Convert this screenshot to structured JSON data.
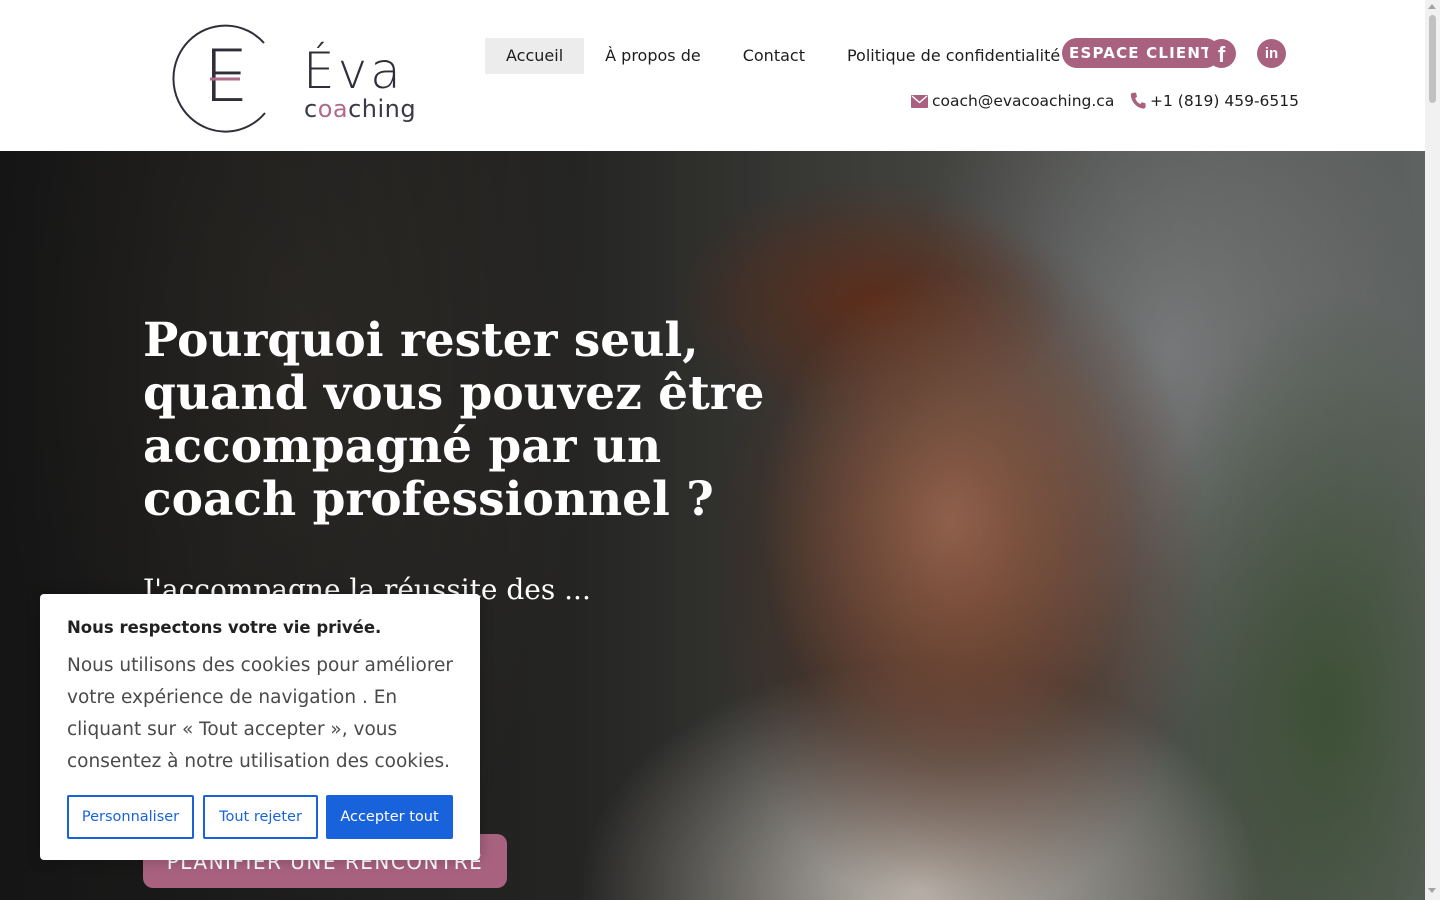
{
  "brand": {
    "logo_letter": "E",
    "name": "Éva",
    "sub_before": "c",
    "sub_highlight": "oa",
    "sub_after": "ching",
    "accent_color": "#a8627f"
  },
  "nav": {
    "items": [
      {
        "label": "Accueil",
        "active": true
      },
      {
        "label": "À propos de",
        "active": false
      },
      {
        "label": "Contact",
        "active": false
      },
      {
        "label": "Politique de confidentialité",
        "active": false
      }
    ]
  },
  "header": {
    "espace_client_label": "ESPACE CLIENT",
    "facebook_icon": "f",
    "linkedin_icon": "in",
    "email": "coach@evacoaching.ca",
    "phone": "+1 (819) 459-6515"
  },
  "hero": {
    "title": "Pourquoi rester seul, quand vous pouvez être accompagné par un coach professionnel ?",
    "subtitle": "J'accompagne la réussite des ... ncrétiser",
    "cta_label": "PLANIFIER UNE RENCONTRE"
  },
  "cookie_banner": {
    "title": "Nous respectons votre vie privée.",
    "text": "Nous utilisons des cookies pour améliorer votre expérience de navigation . En cliquant sur « Tout accepter », vous consentez à notre utilisation des cookies.",
    "customize_label": "Personnaliser",
    "reject_label": "Tout rejeter",
    "accept_label": "Accepter tout",
    "button_color": "#1863dc"
  }
}
